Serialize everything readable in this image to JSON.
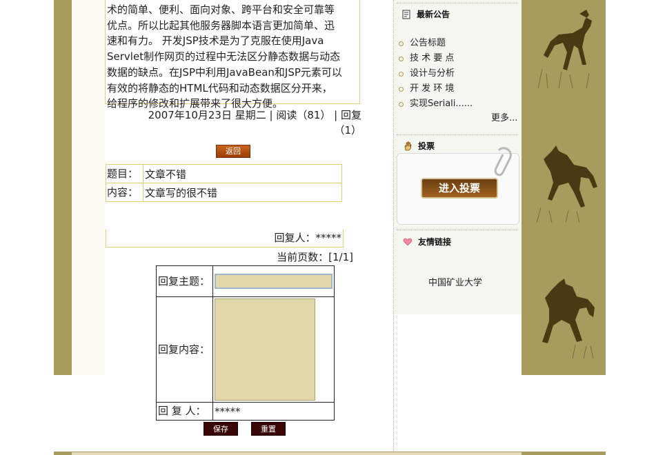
{
  "article": {
    "lines": [
      "术的简单、便利、面向对象、跨平台和安全可靠等",
      "优点。所以比起其他服务器脚本语言更加简单、迅",
      "速和有力。 开发JSP技术是为了克服在使用Java",
      "Servlet制作网页的过程中无法区分静态数据与动态",
      "数据的缺点。在JSP中利用JavaBean和JSP元素可以",
      "有效的将静态的HTML代码和动态数据区分开来，",
      "给程序的修改和扩展带来了很大方便。"
    ],
    "meta_line1": "2007年10月23日 星期二 | 阅读（81） | 回复",
    "meta_line2": "（1）"
  },
  "back_button": "返回",
  "comment": {
    "title_label": "题目：",
    "title_value": "文章不错",
    "content_label": "内容：",
    "content_value": "文章写的很不错",
    "replier": "回复人：*****"
  },
  "pager": "当前页数：[1/1]",
  "reply_form": {
    "subject_label": "回复主题：",
    "subject_value": "",
    "content_label": "回复内容：",
    "content_value": "",
    "author_label": "回 复 人：",
    "author_value": "*****",
    "save_button": "保存",
    "reset_button": "重置"
  },
  "sidebar": {
    "notice_title": "最新公告",
    "notices": [
      "公告标题",
      "技 术 要 点",
      "设计与分析",
      "开 发 环 境",
      "实现Seriali......"
    ],
    "more": "更多...",
    "vote_title": "投票",
    "vote_button": "进入投票",
    "links_title": "友情链接",
    "links": [
      "中国矿业大学"
    ]
  },
  "colors": {
    "band": "#a89b5e",
    "accent_border": "#e7cf78",
    "button_dark": "#3a0505"
  }
}
